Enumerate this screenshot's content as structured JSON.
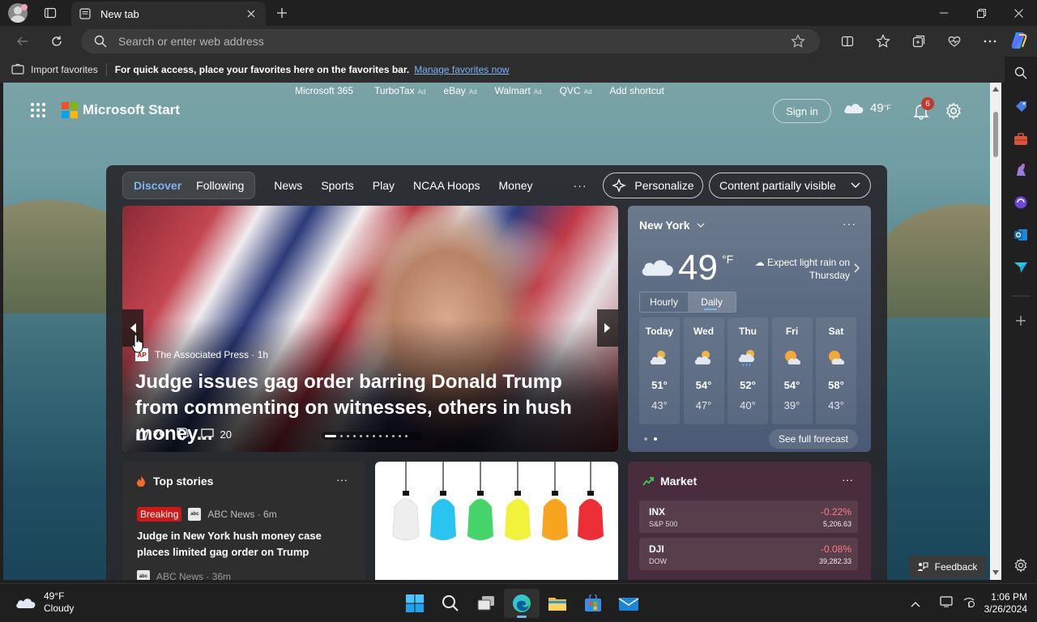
{
  "browser": {
    "tab_title": "New tab",
    "address_placeholder": "Search or enter web address"
  },
  "favorites_bar": {
    "import_label": "Import favorites",
    "message": "For quick access, place your favorites here on the favorites bar.",
    "manage_link": "Manage favorites now"
  },
  "quick_links": [
    {
      "label": "Microsoft 365",
      "ad": ""
    },
    {
      "label": "TurboTax",
      "ad": "Ad"
    },
    {
      "label": "eBay",
      "ad": "Ad"
    },
    {
      "label": "Walmart",
      "ad": "Ad"
    },
    {
      "label": "QVC",
      "ad": "Ad"
    },
    {
      "label": "Add shortcut",
      "ad": ""
    }
  ],
  "header": {
    "brand": "Microsoft Start",
    "sign_in": "Sign in",
    "temp": "49",
    "unit": "°F",
    "notifications": "6"
  },
  "feed_nav": {
    "tabs": [
      "Discover",
      "Following"
    ],
    "links": [
      "News",
      "Sports",
      "Play",
      "NCAA Hoops",
      "Money"
    ],
    "more": "···",
    "personalize": "Personalize",
    "content_visibility": "Content partially visible"
  },
  "hero": {
    "source": "The Associated Press · 1h",
    "source_logo": "AP",
    "title": "Judge issues gag order barring Donald Trump from commenting on witnesses, others in hush money...",
    "likes": "79",
    "comments": "20"
  },
  "weather": {
    "location": "New York",
    "temp": "49",
    "unit": "°F",
    "forecast_note": "Expect light rain on Thursday",
    "toggle": [
      "Hourly",
      "Daily"
    ],
    "days": [
      {
        "name": "Today",
        "hi": "51°",
        "lo": "43°",
        "icon": "partly-cloudy-icon"
      },
      {
        "name": "Wed",
        "hi": "54°",
        "lo": "47°",
        "icon": "partly-cloudy-icon"
      },
      {
        "name": "Thu",
        "hi": "52°",
        "lo": "40°",
        "icon": "rain-icon"
      },
      {
        "name": "Fri",
        "hi": "54°",
        "lo": "39°",
        "icon": "partly-sunny-icon"
      },
      {
        "name": "Sat",
        "hi": "58°",
        "lo": "43°",
        "icon": "partly-sunny-icon"
      }
    ],
    "see_full": "See full forecast"
  },
  "top_stories": {
    "title": "Top stories",
    "badge": "Breaking",
    "source": "ABC News · 6m",
    "headline": "Judge in New York hush money case places limited gag order on Trump",
    "next_source": "ABC News · 36m",
    "logo_text": "abc"
  },
  "market": {
    "title": "Market",
    "rows": [
      {
        "symbol": "INX",
        "name": "S&P 500",
        "change": "-0.22%",
        "value": "5,206.63"
      },
      {
        "symbol": "DJI",
        "name": "DOW",
        "change": "-0.08%",
        "value": "39,282.33"
      }
    ]
  },
  "feedback": "Feedback",
  "taskbar": {
    "temp": "49°F",
    "condition": "Cloudy",
    "time": "1:06 PM",
    "date": "3/26/2024"
  },
  "colors": {
    "accent": "#7fb2f0",
    "breaking": "#d01818",
    "negative": "#ff7a8a",
    "badge": "#c4382c"
  }
}
